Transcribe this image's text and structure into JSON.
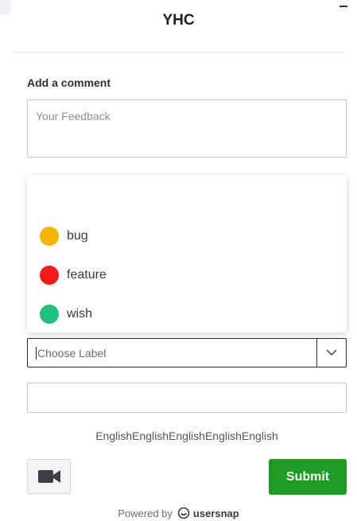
{
  "header": {
    "title": "YHC"
  },
  "comment": {
    "label": "Add a comment",
    "placeholder": "Your Feedback"
  },
  "dropdown": {
    "options": [
      {
        "label": "bug",
        "color": "#f5b400"
      },
      {
        "label": "feature",
        "color": "#f31a1a"
      },
      {
        "label": "wish",
        "color": "#1fbf7e"
      }
    ]
  },
  "label_select": {
    "placeholder": "Choose Label"
  },
  "language_text": "EnglishEnglishEnglishEnglishEnglish",
  "actions": {
    "video_icon": "video-camera-icon",
    "submit_label": "Submit",
    "submit_color": "#1f9a22"
  },
  "footer": {
    "powered_by": "Powered by",
    "brand": "usersnap"
  }
}
